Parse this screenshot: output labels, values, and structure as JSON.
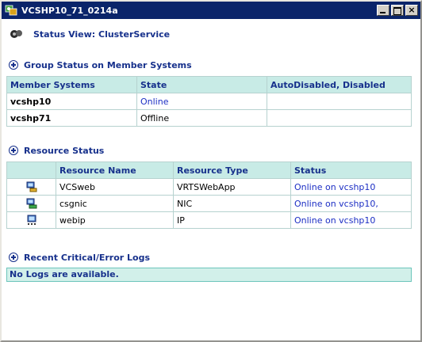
{
  "window": {
    "title": "VCSHP10_71_0214a"
  },
  "status_view": {
    "label": "Status View: ClusterService"
  },
  "group_status": {
    "heading": "Group Status on Member Systems",
    "columns": [
      "Member Systems",
      "State",
      "AutoDisabled, Disabled"
    ],
    "rows": [
      {
        "system": "vcshp10",
        "state": "Online",
        "state_color": "#1c2ec4",
        "flags": ""
      },
      {
        "system": "vcshp71",
        "state": "Offline",
        "state_color": "#000000",
        "flags": ""
      }
    ]
  },
  "resource_status": {
    "heading": "Resource Status",
    "columns": [
      "",
      "Resource Name",
      "Resource Type",
      "Status"
    ],
    "rows": [
      {
        "icon": "web-app-resource-icon",
        "name": "VCSweb",
        "type": "VRTSWebApp",
        "status": "Online on vcshp10"
      },
      {
        "icon": "nic-resource-icon",
        "name": "csgnic",
        "type": "NIC",
        "status": "Online on vcshp10,"
      },
      {
        "icon": "ip-resource-icon",
        "name": "webip",
        "type": "IP",
        "status": "Online on vcshp10"
      }
    ]
  },
  "logs": {
    "heading": "Recent Critical/Error Logs",
    "message": "No Logs are available."
  },
  "colors": {
    "accent": "#17318c",
    "header_bg": "#c8ebe6",
    "titlebar": "#0a246a",
    "online": "#1c2ec4"
  }
}
